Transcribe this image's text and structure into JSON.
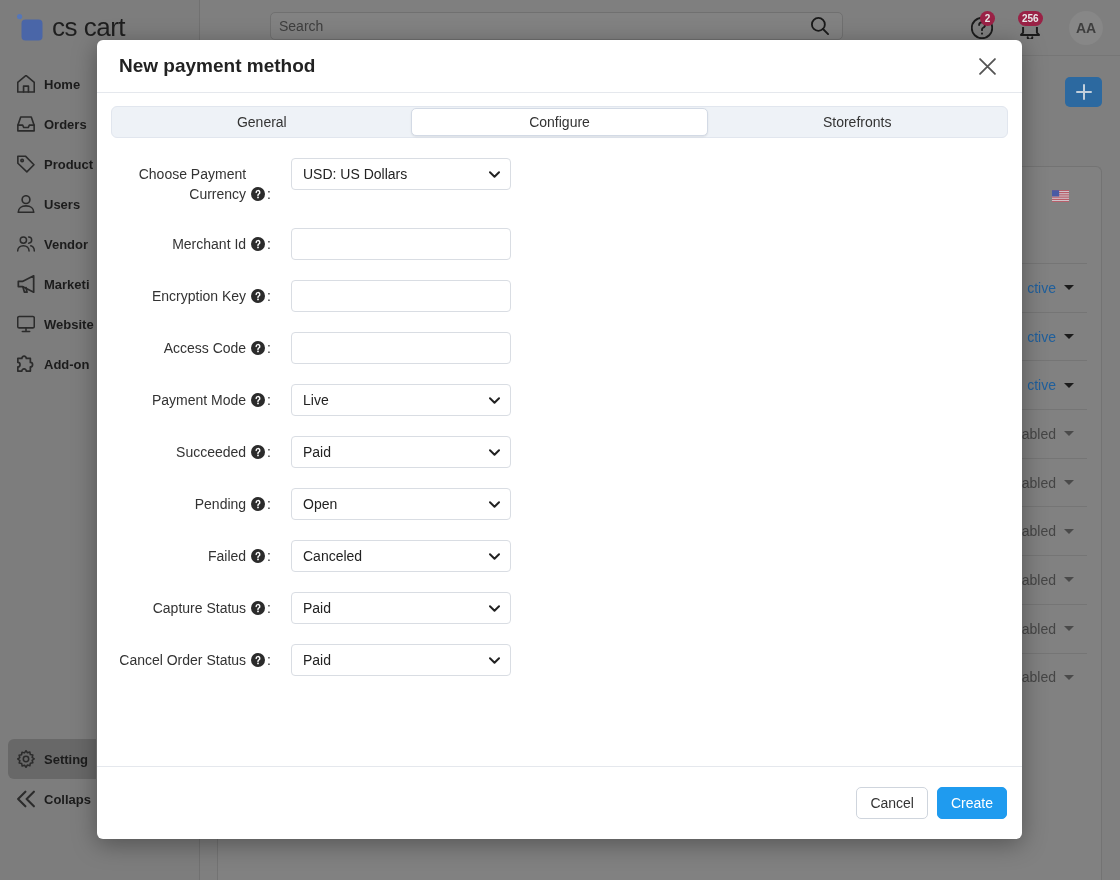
{
  "sidebar": {
    "logo": "cs cart",
    "nav": [
      {
        "label": "Home",
        "selected": false
      },
      {
        "label": "Orders",
        "selected": false
      },
      {
        "label": "Product",
        "selected": false
      },
      {
        "label": "Users",
        "selected": false
      },
      {
        "label": "Vendor",
        "selected": false
      },
      {
        "label": "Marketi",
        "selected": false
      },
      {
        "label": "Website",
        "selected": false
      },
      {
        "label": "Add-on",
        "selected": false
      }
    ],
    "bottom_nav": [
      {
        "label": "Setting",
        "selected": true
      },
      {
        "label": "Collaps",
        "selected": false
      }
    ]
  },
  "topbar": {
    "search": {
      "placeholder": "Search"
    },
    "help_badge": "2",
    "notification_badge": "256",
    "avatar": "AA"
  },
  "content": {
    "rows": [
      {
        "status": "ctive",
        "disabled": false
      },
      {
        "status": "ctive",
        "disabled": false
      },
      {
        "status": "ctive",
        "disabled": false
      },
      {
        "status": "abled",
        "disabled": true
      },
      {
        "status": "abled",
        "disabled": true
      },
      {
        "status": "abled",
        "disabled": true
      },
      {
        "status": "abled",
        "disabled": true
      },
      {
        "status": "abled",
        "disabled": true
      },
      {
        "status": "abled",
        "disabled": true
      }
    ]
  },
  "modal": {
    "title": "New payment method",
    "tabs": [
      {
        "label": "General",
        "selected": false
      },
      {
        "label": "Configure",
        "selected": true
      },
      {
        "label": "Storefronts",
        "selected": false
      }
    ],
    "fields": [
      {
        "label": "Choose Payment Currency",
        "suffix": ":",
        "kind": "select",
        "value": "USD: US Dollars"
      },
      {
        "label": "Merchant Id",
        "suffix": ":",
        "kind": "input"
      },
      {
        "label": "Encryption Key",
        "suffix": ":",
        "kind": "input"
      },
      {
        "label": "Access Code",
        "suffix": ":",
        "kind": "input"
      },
      {
        "label": "Payment Mode",
        "suffix": ":",
        "kind": "select",
        "value": "Live"
      },
      {
        "label": "Succeeded",
        "suffix": ":",
        "kind": "select",
        "value": "Paid"
      },
      {
        "label": "Pending",
        "suffix": ":",
        "kind": "select",
        "value": "Open"
      },
      {
        "label": "Failed",
        "suffix": ":",
        "kind": "select",
        "value": "Canceled"
      },
      {
        "label": "Capture Status",
        "suffix": ":",
        "kind": "select",
        "value": "Paid"
      },
      {
        "label": "Cancel Order Status",
        "suffix": ":",
        "kind": "select",
        "value": "Paid"
      }
    ],
    "buttons": [
      {
        "label": "Cancel",
        "kind": "secondary"
      },
      {
        "label": "Create",
        "kind": "primary"
      }
    ]
  }
}
